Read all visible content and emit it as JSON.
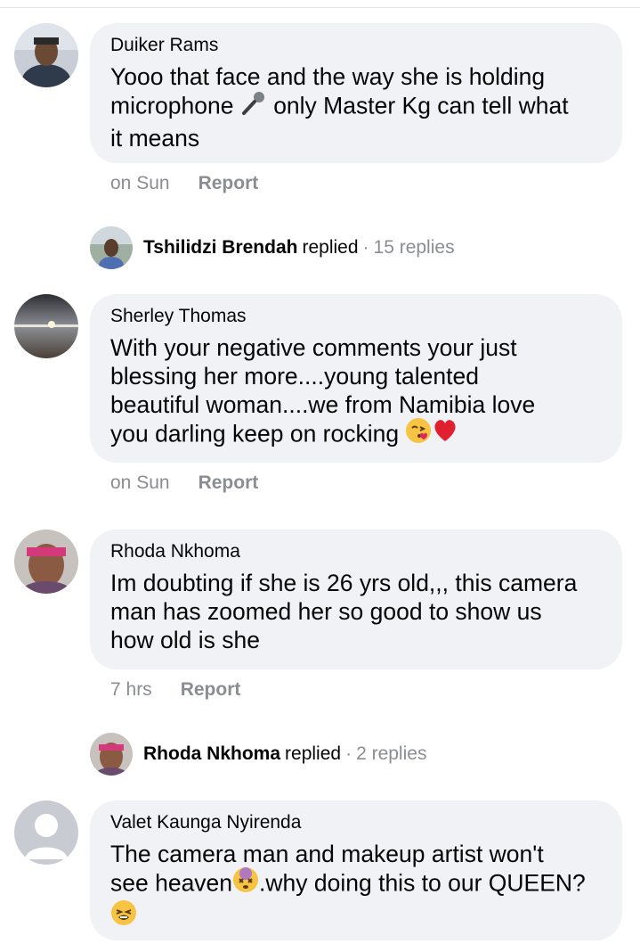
{
  "comments": [
    {
      "author": "Duiker Rams",
      "text_a": "Yooo that face and the way she is holding\nmicrophone ",
      "emoji_a": "microphone-emoji",
      "text_b": " only Master Kg can tell what\nit means",
      "time": "on Sun",
      "report": "Report",
      "avatar": "profile-photo"
    },
    {
      "author": "Sherley Thomas",
      "text_a": "With your negative comments your just\nblessing her more....young talented\nbeautiful woman....we from Namibia love\nyou darling keep on rocking ",
      "emoji_a": "face-blowing-kiss-emoji",
      "emoji_b": "red-heart-emoji",
      "time": "on Sun",
      "report": "Report",
      "avatar": "sunset-photo"
    },
    {
      "author": "Rhoda Nkhoma",
      "text_a": "Im doubting if she is 26 yrs old,,, this camera\nman has zoomed her so good to show us\nhow old is she",
      "time": "7 hrs",
      "report": "Report",
      "avatar": "profile-photo"
    },
    {
      "author": "Valet Kaunga Nyirenda",
      "text_a": "The camera man and makeup artist won't\nsee heaven",
      "emoji_a": "dizzy-face-emoji",
      "text_b": ".why doing this to our QUEEN?\n",
      "emoji_b": "tired-face-emoji",
      "avatar": "default-avatar"
    }
  ],
  "replies": [
    {
      "name": "Tshilidzi Brendah",
      "replied": "replied",
      "separator": "·",
      "count": "15 replies"
    },
    {
      "name": "Rhoda Nkhoma",
      "replied": "replied",
      "separator": "·",
      "count": "2 replies"
    }
  ],
  "colors": {
    "bubble": "#f0f2f5",
    "text": "#050505",
    "meta": "#8a8d91"
  }
}
